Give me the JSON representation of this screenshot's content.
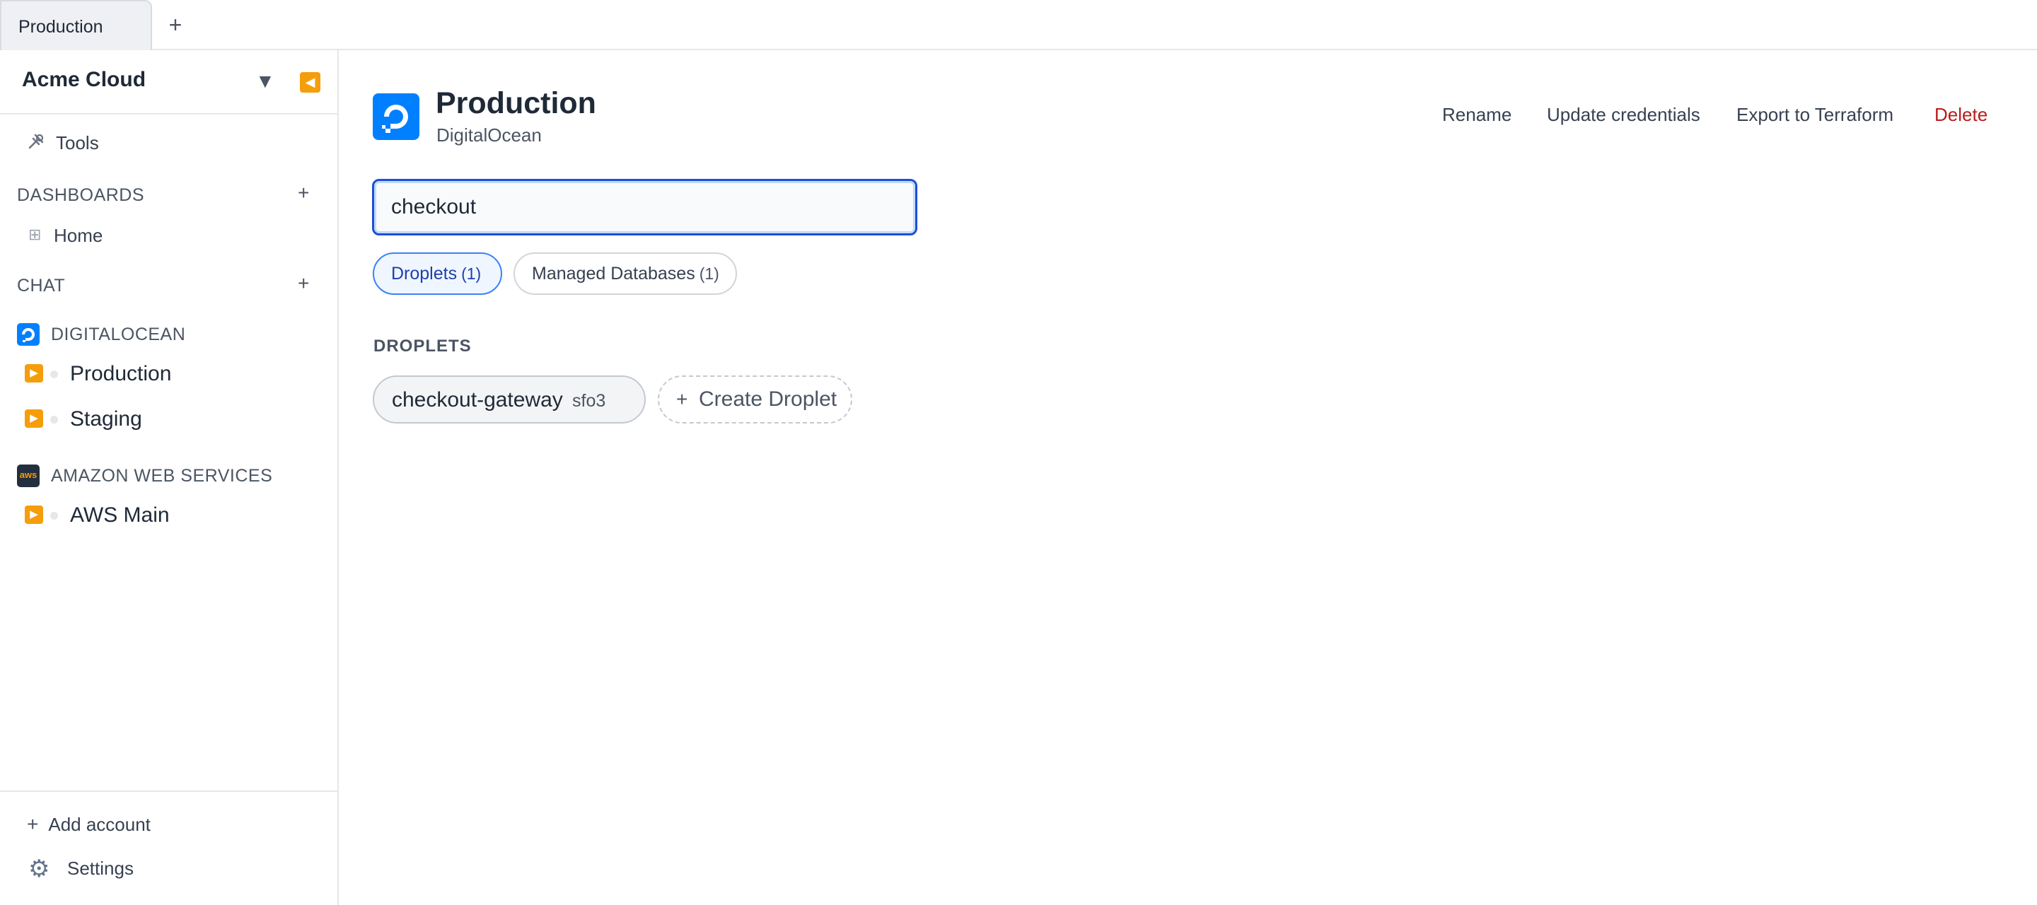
{
  "tabs": [
    {
      "label": "Production"
    }
  ],
  "sidebar": {
    "org_name": "Acme Cloud",
    "tools_label": "Tools",
    "dashboards_heading": "DASHBOARDS",
    "dashboards": [
      {
        "label": "Home"
      }
    ],
    "chat_heading": "CHAT",
    "providers": [
      {
        "name": "DIGITALOCEAN",
        "logo": "digitalocean-logo",
        "accounts": [
          {
            "label": "Production"
          },
          {
            "label": "Staging"
          }
        ]
      },
      {
        "name": "AMAZON WEB SERVICES",
        "logo_text": "aws",
        "accounts": [
          {
            "label": "AWS Main"
          }
        ]
      }
    ],
    "add_account_label": "Add account",
    "settings_label": "Settings"
  },
  "header": {
    "title": "Production",
    "subtitle": "DigitalOcean",
    "actions": {
      "rename": "Rename",
      "update_credentials": "Update credentials",
      "export": "Export to Terraform",
      "delete": "Delete"
    }
  },
  "search": {
    "value": "checkout"
  },
  "filters": [
    {
      "label": "Droplets",
      "count": "(1)",
      "active": true
    },
    {
      "label": "Managed Databases",
      "count": "(1)",
      "active": false
    }
  ],
  "droplets": {
    "heading": "DROPLETS",
    "items": [
      {
        "name": "checkout-gateway",
        "region": "sfo3"
      }
    ],
    "create_label": "Create Droplet"
  },
  "colors": {
    "accent": "#1d4ed8",
    "warning": "#f59e0b",
    "danger": "#b91c1c",
    "digitalocean": "#0080ff"
  }
}
